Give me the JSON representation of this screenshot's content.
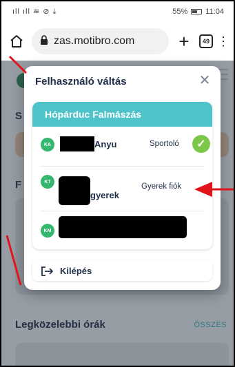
{
  "status_bar": {
    "signals": "ıll ıll ≋ ⊘ ⤓",
    "battery_text": "55%",
    "time": "11:04"
  },
  "browser": {
    "url": "zas.motibro.com",
    "tab_count": "49",
    "new_tab_symbol": "+"
  },
  "background": {
    "section_label_s": "S",
    "section_label_f": "F",
    "upcoming_title": "Legközelebbi órák",
    "see_all": "ÖSSZES"
  },
  "modal": {
    "title": "Felhasználó váltás",
    "close_symbol": "✕",
    "club_name": "Hópárduc Falmászás",
    "accounts": [
      {
        "initials": "KA",
        "name_visible": "Anyu",
        "role": "Sportoló",
        "selected": true
      },
      {
        "initials": "KT",
        "name_visible": "gyerek",
        "role": "Gyerek fiók",
        "selected": false
      },
      {
        "initials": "KM",
        "name_visible": "",
        "role": "",
        "selected": false
      }
    ],
    "logout_label": "Kilépés"
  },
  "colors": {
    "teal_header": "#4ec3c9",
    "avatar_green": "#35b76f",
    "check_green": "#7cc74a",
    "annotation_red": "#e0151c"
  }
}
